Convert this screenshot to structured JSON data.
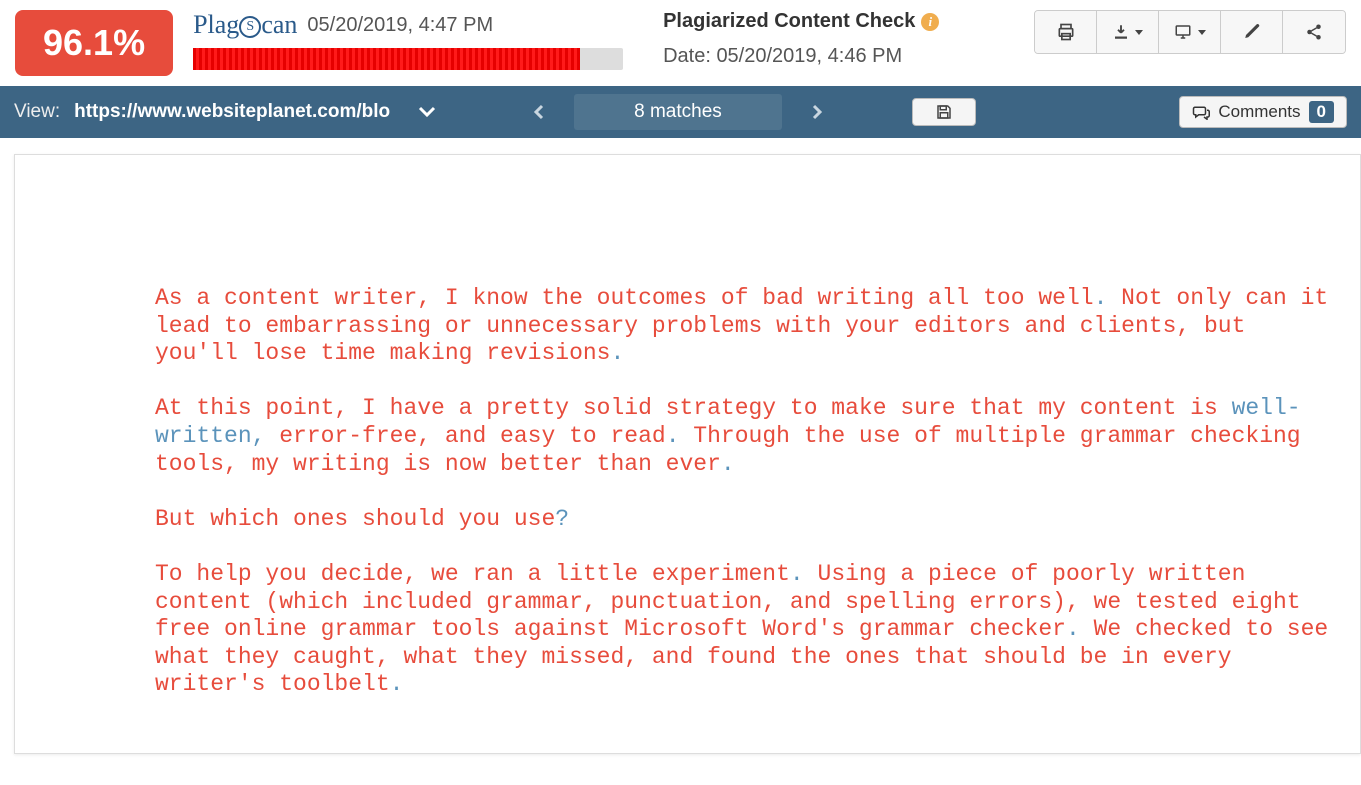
{
  "header": {
    "score": "96.1%",
    "logo_parts": {
      "pre": "Plag",
      "mid": "S",
      "post": "can"
    },
    "timestamp": "05/20/2019, 4:47 PM",
    "progress_percent": 90
  },
  "meta": {
    "title": "Plagiarized Content Check",
    "date_label": "Date: 05/20/2019, 4:46 PM"
  },
  "subbar": {
    "view_label": "View:",
    "view_url": "https://www.websiteplanet.com/blo",
    "matches": "8 matches",
    "comments_label": "Comments",
    "comments_count": "0"
  },
  "document": {
    "p1a": "As a content writer, I know the outcomes of bad writing all too well",
    "p1b": " Not only can it lead to embarrassing or unnecessary problems with your editors and clients, but you'll lose time making revisions",
    "p2a": "At this point, I have a pretty solid strategy to make sure that my content is ",
    "p2blue": "well-written,",
    "p2b": " error-free, and easy to read",
    "p2c": " Through the use of multiple grammar checking tools, my writing is now better than ever",
    "p3": "But which ones should you use",
    "p4a": "To help you decide, we ran a little experiment",
    "p4b": " Using a piece of poorly written content (which included grammar, punctuation, and spelling errors), we tested eight free online grammar tools against Microsoft Word's grammar checker",
    "p4c": " We checked to see what they caught, what they missed, and found the ones that should be in every writer's toolbelt",
    "dot": ".",
    "qmark": "?"
  },
  "colors": {
    "plagiarized": "#e74c3c",
    "original": "#5b93bb"
  }
}
